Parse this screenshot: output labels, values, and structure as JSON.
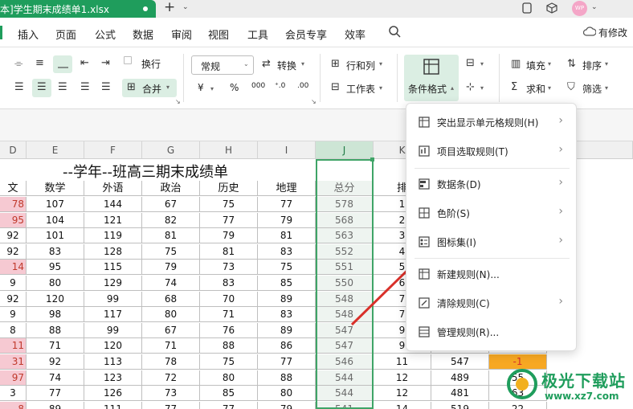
{
  "window": {
    "tab_title": "本]学生期末成绩单1.xlsx",
    "plus": "+",
    "caret": "⌄",
    "avatar": "WP"
  },
  "menu": {
    "items": [
      "插入",
      "页面",
      "公式",
      "数据",
      "审阅",
      "视图",
      "工具",
      "会员专享",
      "效率"
    ],
    "revise_label": "有修改"
  },
  "ribbon": {
    "wrap_label": "换行",
    "number_format": "常规",
    "convert_label": "转换",
    "rowcol_label": "行和列",
    "sheet_label": "工作表",
    "cond_format_label": "条件格式",
    "fill_label": "填充",
    "sort_label": "排序",
    "sum_label": "求和",
    "filter_label": "筛选",
    "merge_label": "合并",
    "currency": "¥",
    "percent": "%",
    "thousands": "000",
    "dec_more": "⁺.0",
    "dec_less": ".00"
  },
  "sheet": {
    "title": "--学年--班高三期末成绩单",
    "col_letters": [
      "D",
      "E",
      "F",
      "G",
      "H",
      "I",
      "J",
      "K"
    ],
    "headers": [
      "文",
      "数学",
      "外语",
      "政治",
      "历史",
      "地理",
      "总分",
      "排"
    ],
    "rows": [
      [
        "78",
        "107",
        "144",
        "67",
        "75",
        "77",
        "578",
        "1"
      ],
      [
        "95",
        "104",
        "121",
        "82",
        "77",
        "79",
        "568",
        "2"
      ],
      [
        "92",
        "101",
        "119",
        "81",
        "79",
        "81",
        "563",
        "3"
      ],
      [
        "92",
        "83",
        "128",
        "75",
        "81",
        "83",
        "552",
        "4"
      ],
      [
        "14",
        "95",
        "115",
        "79",
        "73",
        "75",
        "551",
        "5"
      ],
      [
        "9",
        "80",
        "129",
        "74",
        "83",
        "85",
        "550",
        "6"
      ],
      [
        "92",
        "120",
        "99",
        "68",
        "70",
        "89",
        "548",
        "7"
      ],
      [
        "9",
        "98",
        "117",
        "80",
        "71",
        "83",
        "548",
        "7"
      ],
      [
        "8",
        "88",
        "99",
        "67",
        "76",
        "89",
        "547",
        "9"
      ],
      [
        "11",
        "71",
        "120",
        "71",
        "88",
        "86",
        "547",
        "9"
      ],
      [
        "31",
        "92",
        "113",
        "78",
        "75",
        "77",
        "546",
        "11"
      ],
      [
        "97",
        "74",
        "123",
        "72",
        "80",
        "88",
        "544",
        "12"
      ],
      [
        "3",
        "77",
        "126",
        "73",
        "85",
        "80",
        "544",
        "12"
      ],
      [
        "8",
        "89",
        "111",
        "77",
        "77",
        "79",
        "541",
        "14"
      ]
    ],
    "pink_rows": [
      0,
      1,
      4,
      9,
      10,
      11,
      13
    ],
    "extra_L": [
      "",
      "",
      "",
      "",
      "",
      "",
      "",
      "",
      "",
      "",
      "547",
      "489",
      "481",
      "519"
    ],
    "extra_M": [
      "",
      "",
      "",
      "",
      "",
      "",
      "",
      "",
      "",
      "",
      "-1",
      "55",
      "63",
      "22"
    ]
  },
  "dropdown": {
    "items": [
      {
        "label": "突出显示单元格规则(H)",
        "icon": "highlight-rules-icon",
        "submenu": true
      },
      {
        "label": "项目选取规则(T)",
        "icon": "top-bottom-rules-icon",
        "submenu": true
      },
      {
        "label": "数据条(D)",
        "icon": "data-bars-icon",
        "submenu": true
      },
      {
        "label": "色阶(S)",
        "icon": "color-scales-icon",
        "submenu": true
      },
      {
        "label": "图标集(I)",
        "icon": "icon-sets-icon",
        "submenu": true
      },
      {
        "label": "新建规则(N)...",
        "icon": "new-rule-icon",
        "submenu": false
      },
      {
        "label": "清除规则(C)",
        "icon": "clear-rules-icon",
        "submenu": true
      },
      {
        "label": "管理规则(R)...",
        "icon": "manage-rules-icon",
        "submenu": false
      }
    ]
  },
  "watermark": {
    "text": "极光下载站",
    "url": "www.xz7.com"
  },
  "colors": {
    "accent": "#1f9d5c",
    "selected_column": "#3fa467",
    "pink_cell": "#f6c9d2",
    "orange_cell": "#f7a823",
    "arrow": "#d9302a"
  }
}
